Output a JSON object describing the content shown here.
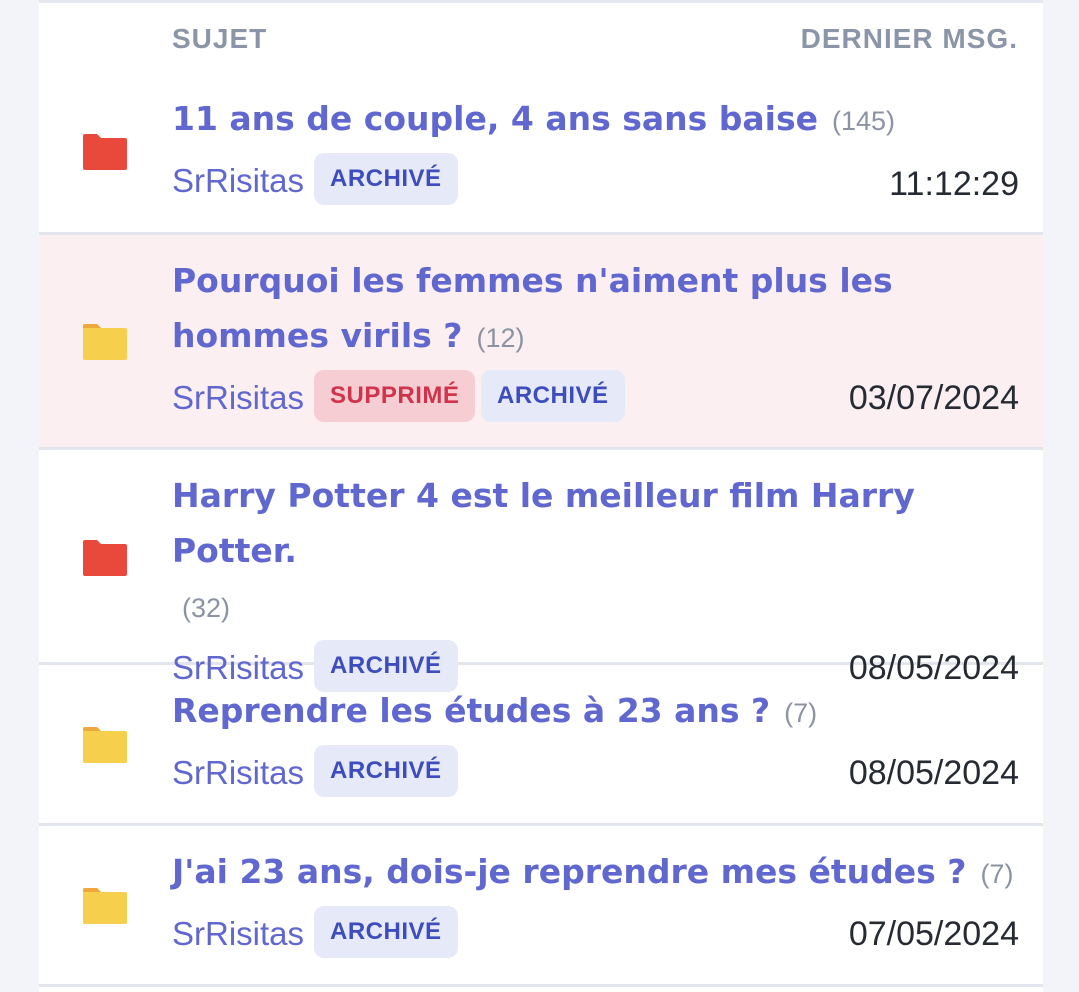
{
  "header": {
    "subject": "SUJET",
    "last_message": "DERNIER MSG."
  },
  "topics": [
    {
      "title": "11 ans de couple, 4 ans sans baise",
      "count": "(145)",
      "author": "SrRisitas",
      "badges": [
        "ARCHIVÉ"
      ],
      "date": "11:12:29",
      "folder_color": "#e8493a",
      "deleted": false
    },
    {
      "title": "Pourquoi les femmes n'aiment plus les hommes virils ?",
      "count": "(12)",
      "author": "SrRisitas",
      "badges": [
        "SUPPRIMÉ",
        "ARCHIVÉ"
      ],
      "date": "03/07/2024",
      "folder_color": "#f6cf4c",
      "deleted": true
    },
    {
      "title": "Harry Potter 4 est le meilleur film Harry Potter.",
      "count": "(32)",
      "author": "SrRisitas",
      "badges": [
        "ARCHIVÉ"
      ],
      "date": "08/05/2024",
      "folder_color": "#e8493a",
      "deleted": false
    },
    {
      "title": "Reprendre les études à 23 ans ?",
      "count": "(7)",
      "author": "SrRisitas",
      "badges": [
        "ARCHIVÉ"
      ],
      "date": "08/05/2024",
      "folder_color": "#f6cf4c",
      "deleted": false
    },
    {
      "title": "J'ai 23 ans, dois-je reprendre mes études ?",
      "count": "(7)",
      "author": "SrRisitas",
      "badges": [
        "ARCHIVÉ"
      ],
      "date": "07/05/2024",
      "folder_color": "#f6cf4c",
      "deleted": false
    }
  ]
}
